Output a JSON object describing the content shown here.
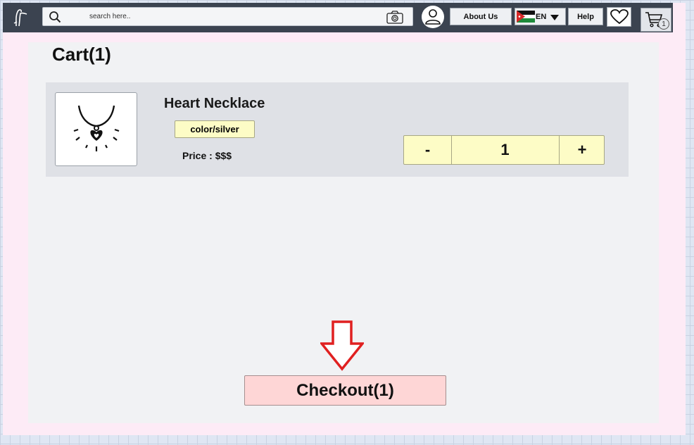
{
  "header": {
    "search_placeholder": "search here..",
    "about_label": "About Us",
    "lang_label": "EN",
    "help_label": "Help",
    "cart_count": "1",
    "icons": [
      "logo-icon",
      "search-icon",
      "camera-icon",
      "user-icon",
      "flag-icon",
      "caret-down-icon",
      "heart-icon",
      "cart-icon"
    ]
  },
  "cart": {
    "title": "Cart(1)",
    "items": [
      {
        "name": "Heart Necklace",
        "variant": "color/silver",
        "price": "Price : $$$",
        "qty": "1",
        "minus_label": "-",
        "plus_label": "+",
        "icon": "necklace-icon"
      }
    ],
    "checkout_label": "Checkout(1)"
  },
  "colors": {
    "topbar": "#3b4350",
    "page": "#fdebf6",
    "panel": "#f1f2f4",
    "item_bg": "#dfe1e6",
    "yellow": "#fdfcc6",
    "checkout": "#fed6d6",
    "arrow": "#e02020"
  }
}
